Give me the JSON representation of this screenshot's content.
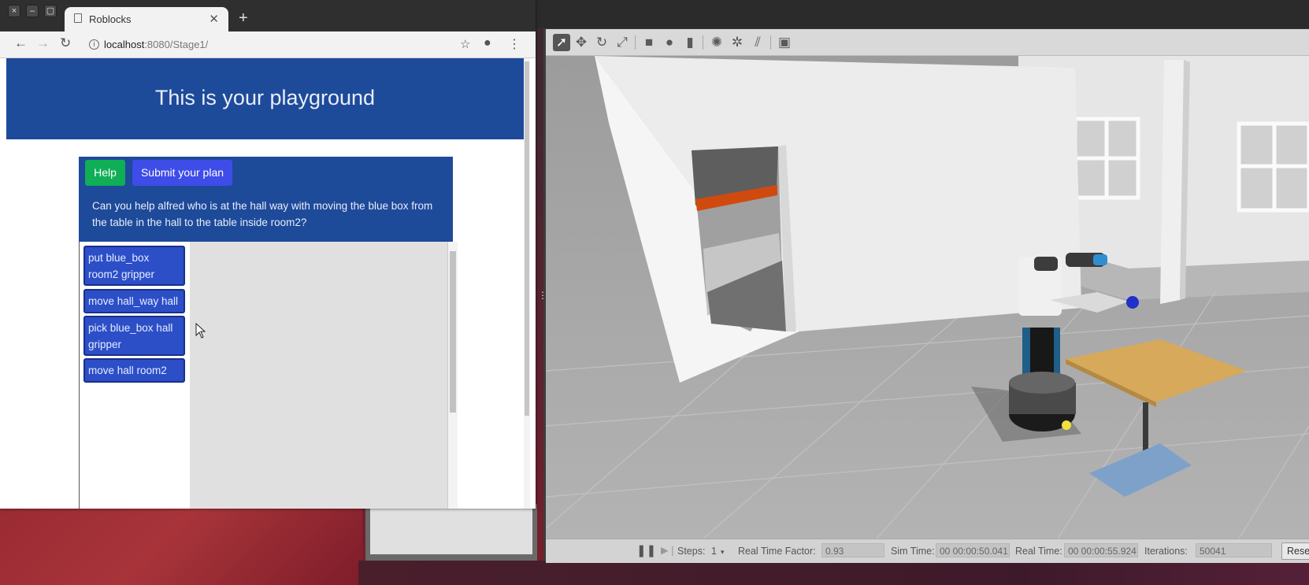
{
  "browser": {
    "tab_title": "Roblocks",
    "url_host": "localhost",
    "url_rest": ":8080/Stage1/",
    "window_buttons": [
      "×",
      "–",
      "▢"
    ]
  },
  "page": {
    "banner_title": "This is your playground",
    "help_label": "Help",
    "submit_label": "Submit your plan",
    "task_text": "Can you help alfred who is at the hall way with moving the blue box from the table in the hall to the table inside room2?",
    "blocks": [
      {
        "label": "put blue_box room2 gripper"
      },
      {
        "label": "move hall_way hall"
      },
      {
        "label": "pick blue_box hall gripper"
      },
      {
        "label": "move hall room2"
      }
    ]
  },
  "gazebo": {
    "toolbar_icons": [
      "select-arrow-icon",
      "translate-icon",
      "rotate-icon",
      "scale-icon",
      "box-icon",
      "sphere-icon",
      "cylinder-icon",
      "point-light-icon",
      "spot-light-icon",
      "directional-light-icon",
      "screenshot-icon"
    ],
    "status": {
      "steps_label": "Steps:",
      "steps_value": "1",
      "rtf_label": "Real Time Factor:",
      "rtf_value": "0.93",
      "sim_time_label": "Sim Time:",
      "sim_time_value": "00 00:00:50.041",
      "real_time_label": "Real Time:",
      "real_time_value": "00 00:00:55.924",
      "iterations_label": "Iterations:",
      "iterations_value": "50041",
      "reset_label": "Reset"
    }
  },
  "colors": {
    "banner": "#1e4a9a",
    "help": "#0fae57",
    "submit": "#3e4ce8",
    "block": "#2c4fc8"
  }
}
